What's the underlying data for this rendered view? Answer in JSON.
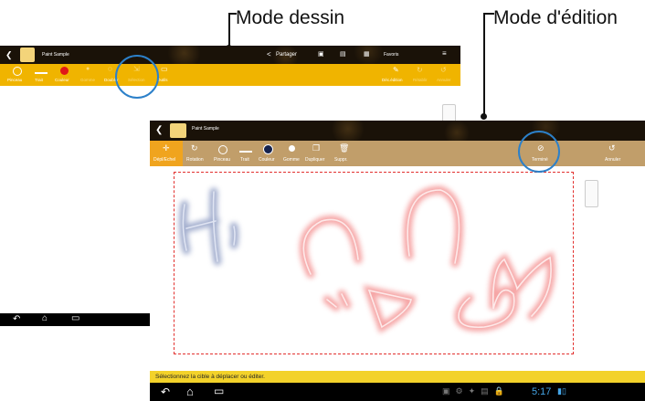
{
  "callouts": {
    "draw_mode": "Mode dessin",
    "edit_mode": "Mode d'édition"
  },
  "draw_screen": {
    "app_title": "Paint Sample",
    "share_label": "Partager",
    "favorites_label": "Favoris",
    "tools": [
      "Pinceau",
      "Trait",
      "Couleur",
      "Gomme",
      "Doubler",
      "Sélection",
      "Outils"
    ],
    "right_tools": [
      "Déc.édition",
      "Rétablir",
      "Annuler"
    ]
  },
  "edit_screen": {
    "app_title": "Paint Sample",
    "tools": [
      "Dépl/Echel",
      "Rotation",
      "Pinceau",
      "Trait",
      "Couleur",
      "Gomme",
      "Dupliquer",
      "Suppr."
    ],
    "done_label": "Terminé",
    "undo_label": "Annuler",
    "status_message": "Sélectionnez la cible à déplacer ou éditer.",
    "clock": "5:17"
  },
  "colors": {
    "toolbar_yellow": "#f0b400",
    "edit_toolbar": "#c19e6a",
    "status_yellow": "#f3d22a",
    "selection_red": "#e2302e",
    "highlight_blue": "#2c80c9"
  }
}
